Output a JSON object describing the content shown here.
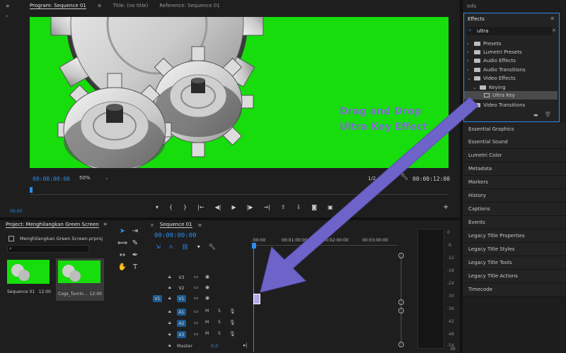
{
  "program": {
    "tabs": [
      "Program: Sequence 01",
      "Title: (no title)",
      "Reference: Sequence 01"
    ],
    "timecode_left": "00:00:00:00",
    "zoom": "50%",
    "fraction": "1/2",
    "timecode_right": "00:00:12:00",
    "overlay_line1": "Drag and Drop",
    "overlay_line2": "Ultra Key Effect",
    "left_timecode_small": "00:00"
  },
  "info_tab": "Info",
  "effects": {
    "title": "Effects",
    "search_value": "ultra",
    "tree": [
      {
        "label": "Presets"
      },
      {
        "label": "Lumetri Presets"
      },
      {
        "label": "Audio Effects"
      },
      {
        "label": "Audio Transitions"
      },
      {
        "label": "Video Effects"
      },
      {
        "label": "Keying"
      },
      {
        "label": "Ultra Key"
      },
      {
        "label": "Video Transitions"
      }
    ]
  },
  "right_panels": [
    "Essential Graphics",
    "Essential Sound",
    "Lumetri Color",
    "Metadata",
    "Markers",
    "History",
    "Captions",
    "Events",
    "Legacy Title Properties",
    "Legacy Title Styles",
    "Legacy Title Tools",
    "Legacy Title Actions",
    "Timecode"
  ],
  "project": {
    "tab": "Project: Menghilangkan Green Screen",
    "file": "Menghilangkan Green Screen.prproj",
    "items": [
      {
        "name": "Sequence 01",
        "duration": "12:00"
      },
      {
        "name": "Cogs_Turnin...",
        "duration": "12:00"
      }
    ]
  },
  "timeline": {
    "tab": "Sequence 01",
    "timecode": "00:00:00:00",
    "ruler": [
      ":00:00",
      "00:01:00:00",
      "00:02:00:00",
      "00:03:00:00"
    ],
    "tracks": [
      {
        "label": "V3"
      },
      {
        "label": "V2"
      },
      {
        "label": "V1"
      },
      {
        "label": "A1"
      },
      {
        "label": "A2"
      },
      {
        "label": "A3"
      }
    ],
    "source_v1": "V1",
    "master_label": "Master",
    "master_value": "0,0"
  },
  "meter": {
    "ticks": [
      "0",
      "-6",
      "-12",
      "-18",
      "-24",
      "-30",
      "-36",
      "-42",
      "-48",
      "-54"
    ],
    "unit": "dB"
  },
  "colors": {
    "green_screen": "#16dd0b",
    "accent_blue": "#2d8ceb",
    "arrow": "#6e63c9",
    "overlay_text": "#7f6fd6"
  }
}
